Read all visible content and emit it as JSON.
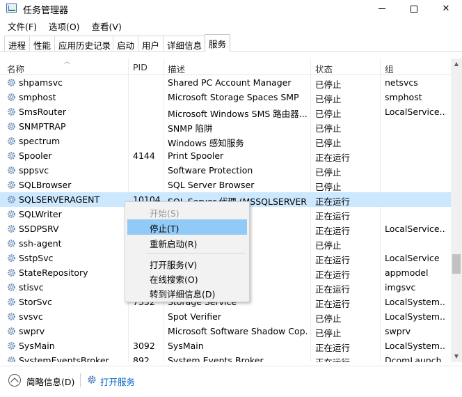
{
  "window": {
    "title": "任务管理器",
    "close_glyph": "✕"
  },
  "menu": [
    "文件(F)",
    "选项(O)",
    "查看(V)"
  ],
  "tabs": [
    "进程",
    "性能",
    "应用历史记录",
    "启动",
    "用户",
    "详细信息",
    "服务"
  ],
  "active_tab": "服务",
  "columns": {
    "name": "名称",
    "pid": "PID",
    "desc": "描述",
    "status": "状态",
    "group": "组"
  },
  "rows": [
    {
      "name": "shpamsvc",
      "pid": "",
      "desc": "Shared PC Account Manager",
      "status": "已停止",
      "group": "netsvcs"
    },
    {
      "name": "smphost",
      "pid": "",
      "desc": "Microsoft Storage Spaces SMP",
      "status": "已停止",
      "group": "smphost"
    },
    {
      "name": "SmsRouter",
      "pid": "",
      "desc": "Microsoft Windows SMS 路由器...",
      "status": "已停止",
      "group": "LocalService..."
    },
    {
      "name": "SNMPTRAP",
      "pid": "",
      "desc": "SNMP 陷阱",
      "status": "已停止",
      "group": ""
    },
    {
      "name": "spectrum",
      "pid": "",
      "desc": "Windows 感知服务",
      "status": "已停止",
      "group": ""
    },
    {
      "name": "Spooler",
      "pid": "4144",
      "desc": "Print Spooler",
      "status": "正在运行",
      "group": ""
    },
    {
      "name": "sppsvc",
      "pid": "",
      "desc": "Software Protection",
      "status": "已停止",
      "group": ""
    },
    {
      "name": "SQLBrowser",
      "pid": "",
      "desc": "SQL Server Browser",
      "status": "已停止",
      "group": ""
    },
    {
      "name": "SQLSERVERAGENT",
      "pid": "10104",
      "desc": "SQL Server 代理 (MSSQLSERVER)",
      "status": "正在运行",
      "group": ""
    },
    {
      "name": "SQLWriter",
      "pid": "",
      "desc": "ter",
      "status": "正在运行",
      "group": ""
    },
    {
      "name": "SSDPSRV",
      "pid": "",
      "desc": "",
      "status": "正在运行",
      "group": "LocalService..."
    },
    {
      "name": "ssh-agent",
      "pid": "",
      "desc": "tion Agent",
      "status": "已停止",
      "group": ""
    },
    {
      "name": "SstpSvc",
      "pid": "",
      "desc": "eling Protoc...",
      "status": "正在运行",
      "group": "LocalService"
    },
    {
      "name": "StateRepository",
      "pid": "",
      "desc": "vice",
      "status": "正在运行",
      "group": "appmodel"
    },
    {
      "name": "stisvc",
      "pid": "",
      "desc": "quisition (WIA)",
      "status": "正在运行",
      "group": "imgsvc"
    },
    {
      "name": "StorSvc",
      "pid": "7352",
      "desc": "Storage Service",
      "status": "正在运行",
      "group": "LocalSystem..."
    },
    {
      "name": "svsvc",
      "pid": "",
      "desc": "Spot Verifier",
      "status": "已停止",
      "group": "LocalSystem..."
    },
    {
      "name": "swprv",
      "pid": "",
      "desc": "Microsoft Software Shadow Cop...",
      "status": "已停止",
      "group": "swprv"
    },
    {
      "name": "SysMain",
      "pid": "3092",
      "desc": "SysMain",
      "status": "正在运行",
      "group": "LocalSystem..."
    },
    {
      "name": "SystemEventsBroker",
      "pid": "892",
      "desc": "System Events Broker",
      "status": "正在运行",
      "group": "DcomLaunch"
    }
  ],
  "context_menu": {
    "start": "开始(S)",
    "stop": "停止(T)",
    "restart": "重新启动(R)",
    "open_services": "打开服务(V)",
    "search_online": "在线搜索(O)",
    "goto_details": "转到详细信息(D)"
  },
  "footer": {
    "summary": "简略信息(D)",
    "open_services": "打开服务"
  },
  "colors": {
    "selection": "#cce8ff",
    "menu_hover": "#91c9f7",
    "link": "#0563c1"
  }
}
